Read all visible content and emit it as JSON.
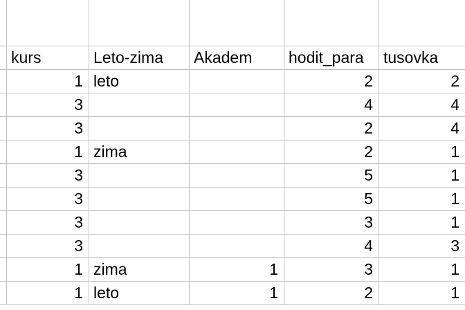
{
  "sheet": {
    "headers": [
      "kurs",
      "Leto-zima",
      "Akadem",
      "hodit_para",
      "tusovka"
    ],
    "rows": [
      {
        "kurs": "1",
        "leto_zima": "leto",
        "akadem": "",
        "hodit_para": "2",
        "tusovka": "2"
      },
      {
        "kurs": "3",
        "leto_zima": "",
        "akadem": "",
        "hodit_para": "4",
        "tusovka": "4"
      },
      {
        "kurs": "3",
        "leto_zima": "",
        "akadem": "",
        "hodit_para": "2",
        "tusovka": "4"
      },
      {
        "kurs": "1",
        "leto_zima": "zima",
        "akadem": "",
        "hodit_para": "2",
        "tusovka": "1"
      },
      {
        "kurs": "3",
        "leto_zima": "",
        "akadem": "",
        "hodit_para": "5",
        "tusovka": "1"
      },
      {
        "kurs": "3",
        "leto_zima": "",
        "akadem": "",
        "hodit_para": "5",
        "tusovka": "1"
      },
      {
        "kurs": "3",
        "leto_zima": "",
        "akadem": "",
        "hodit_para": "3",
        "tusovka": "1"
      },
      {
        "kurs": "3",
        "leto_zima": "",
        "akadem": "",
        "hodit_para": "4",
        "tusovka": "3"
      },
      {
        "kurs": "1",
        "leto_zima": "zima",
        "akadem": "1",
        "hodit_para": "3",
        "tusovka": "1"
      },
      {
        "kurs": "1",
        "leto_zima": "leto",
        "akadem": "1",
        "hodit_para": "2",
        "tusovka": "1"
      }
    ]
  }
}
